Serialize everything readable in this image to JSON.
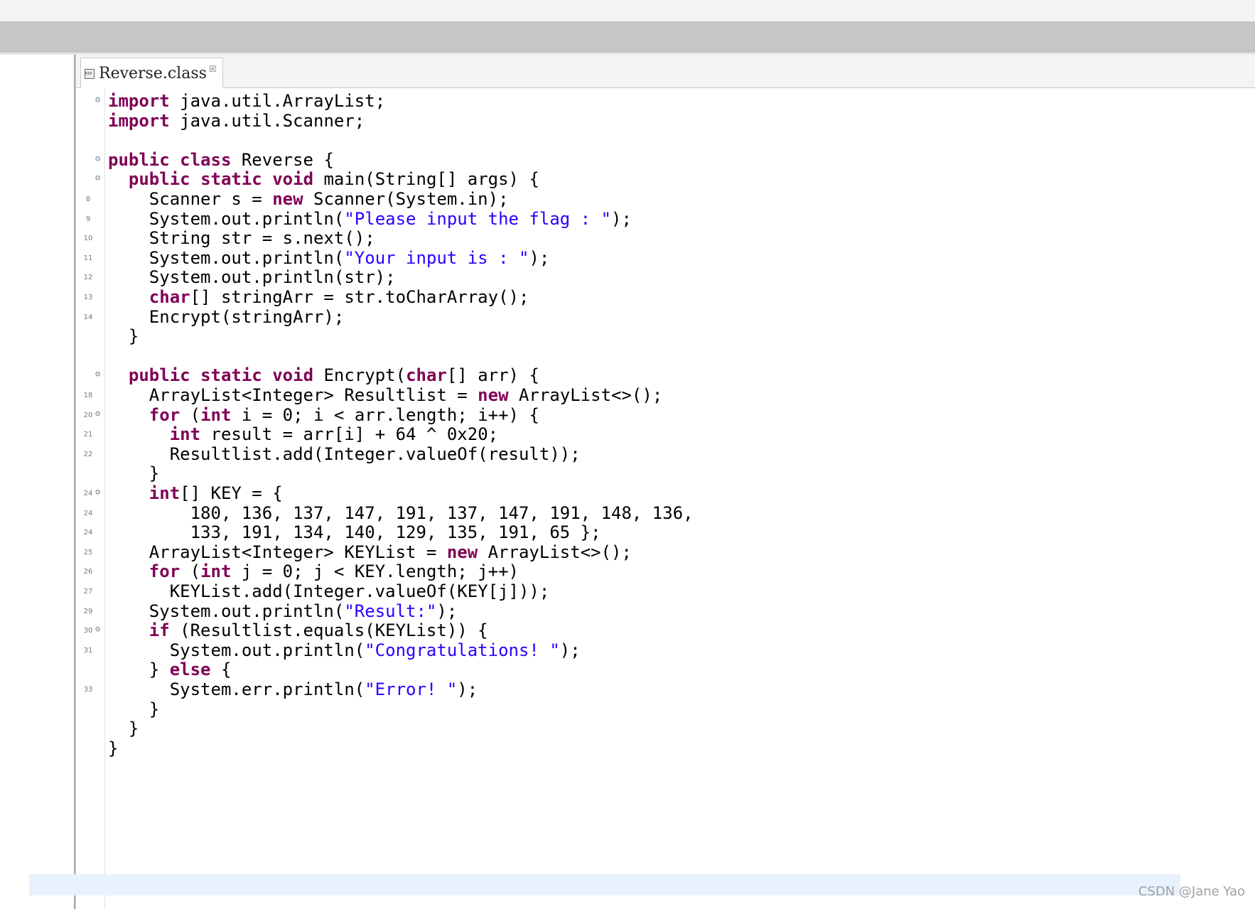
{
  "editor": {
    "tab_label": "Reverse.class",
    "close_glyph": "☒",
    "fold_glyph": "⊝"
  },
  "code_lines": [
    {
      "num": "",
      "fold": true,
      "segs": [
        {
          "t": "import",
          "k": "kw"
        },
        {
          "t": " java.util.ArrayList;"
        }
      ]
    },
    {
      "num": "",
      "fold": false,
      "segs": [
        {
          "t": "import",
          "k": "kw"
        },
        {
          "t": " java.util.Scanner;"
        }
      ]
    },
    {
      "num": "",
      "fold": false,
      "segs": []
    },
    {
      "num": "",
      "fold": true,
      "segs": [
        {
          "t": "public",
          "k": "kw"
        },
        {
          "t": " "
        },
        {
          "t": "class",
          "k": "kw"
        },
        {
          "t": " Reverse {"
        }
      ]
    },
    {
      "num": "",
      "fold": true,
      "segs": [
        {
          "t": "  "
        },
        {
          "t": "public",
          "k": "kw"
        },
        {
          "t": " "
        },
        {
          "t": "static",
          "k": "kw"
        },
        {
          "t": " "
        },
        {
          "t": "void",
          "k": "kw"
        },
        {
          "t": " main(String[] args) {"
        }
      ]
    },
    {
      "num": "8",
      "fold": false,
      "segs": [
        {
          "t": "    Scanner s = "
        },
        {
          "t": "new",
          "k": "kw"
        },
        {
          "t": " Scanner(System.in);"
        }
      ]
    },
    {
      "num": "9",
      "fold": false,
      "segs": [
        {
          "t": "    System.out.println("
        },
        {
          "t": "\"Please input the flag : \"",
          "k": "str"
        },
        {
          "t": ");"
        }
      ]
    },
    {
      "num": "10",
      "fold": false,
      "segs": [
        {
          "t": "    String str = s.next();"
        }
      ]
    },
    {
      "num": "11",
      "fold": false,
      "segs": [
        {
          "t": "    System.out.println("
        },
        {
          "t": "\"Your input is : \"",
          "k": "str"
        },
        {
          "t": ");"
        }
      ]
    },
    {
      "num": "12",
      "fold": false,
      "segs": [
        {
          "t": "    System.out.println(str);"
        }
      ]
    },
    {
      "num": "13",
      "fold": false,
      "segs": [
        {
          "t": "    "
        },
        {
          "t": "char",
          "k": "kw"
        },
        {
          "t": "[] stringArr = str.toCharArray();"
        }
      ]
    },
    {
      "num": "14",
      "fold": false,
      "segs": [
        {
          "t": "    Encrypt(stringArr);"
        }
      ]
    },
    {
      "num": "",
      "fold": false,
      "segs": [
        {
          "t": "  }"
        }
      ]
    },
    {
      "num": "",
      "fold": false,
      "segs": []
    },
    {
      "num": "",
      "fold": true,
      "segs": [
        {
          "t": "  "
        },
        {
          "t": "public",
          "k": "kw"
        },
        {
          "t": " "
        },
        {
          "t": "static",
          "k": "kw"
        },
        {
          "t": " "
        },
        {
          "t": "void",
          "k": "kw"
        },
        {
          "t": " Encrypt("
        },
        {
          "t": "char",
          "k": "kw"
        },
        {
          "t": "[] arr) {"
        }
      ]
    },
    {
      "num": "18",
      "fold": false,
      "segs": [
        {
          "t": "    ArrayList<Integer> Resultlist = "
        },
        {
          "t": "new",
          "k": "kw"
        },
        {
          "t": " ArrayList<>();"
        }
      ]
    },
    {
      "num": "20",
      "fold": true,
      "segs": [
        {
          "t": "    "
        },
        {
          "t": "for",
          "k": "kw"
        },
        {
          "t": " ("
        },
        {
          "t": "int",
          "k": "kw"
        },
        {
          "t": " i = 0; i < arr.length; i++) {"
        }
      ]
    },
    {
      "num": "21",
      "fold": false,
      "segs": [
        {
          "t": "      "
        },
        {
          "t": "int",
          "k": "kw"
        },
        {
          "t": " result = arr[i] + 64 ^ 0x20;"
        }
      ]
    },
    {
      "num": "22",
      "fold": false,
      "segs": [
        {
          "t": "      Resultlist.add(Integer.valueOf(result));"
        }
      ]
    },
    {
      "num": "",
      "fold": false,
      "segs": [
        {
          "t": "    }"
        }
      ]
    },
    {
      "num": "24",
      "fold": true,
      "segs": [
        {
          "t": "    "
        },
        {
          "t": "int",
          "k": "kw"
        },
        {
          "t": "[] KEY = {"
        }
      ]
    },
    {
      "num": "24",
      "fold": false,
      "segs": [
        {
          "t": "        180, 136, 137, 147, 191, 137, 147, 191, 148, 136,"
        }
      ]
    },
    {
      "num": "24",
      "fold": false,
      "segs": [
        {
          "t": "        133, 191, 134, 140, 129, 135, 191, 65 };"
        }
      ]
    },
    {
      "num": "25",
      "fold": false,
      "segs": [
        {
          "t": "    ArrayList<Integer> KEYList = "
        },
        {
          "t": "new",
          "k": "kw"
        },
        {
          "t": " ArrayList<>();"
        }
      ]
    },
    {
      "num": "26",
      "fold": false,
      "segs": [
        {
          "t": "    "
        },
        {
          "t": "for",
          "k": "kw"
        },
        {
          "t": " ("
        },
        {
          "t": "int",
          "k": "kw"
        },
        {
          "t": " j = 0; j < KEY.length; j++)"
        }
      ]
    },
    {
      "num": "27",
      "fold": false,
      "segs": [
        {
          "t": "      KEYList.add(Integer.valueOf(KEY[j]));"
        }
      ]
    },
    {
      "num": "29",
      "fold": false,
      "segs": [
        {
          "t": "    System.out.println("
        },
        {
          "t": "\"Result:\"",
          "k": "str"
        },
        {
          "t": ");"
        }
      ]
    },
    {
      "num": "30",
      "fold": true,
      "segs": [
        {
          "t": "    "
        },
        {
          "t": "if",
          "k": "kw"
        },
        {
          "t": " (Resultlist.equals(KEYList)) {"
        }
      ]
    },
    {
      "num": "31",
      "fold": false,
      "segs": [
        {
          "t": "      System.out.println("
        },
        {
          "t": "\"Congratulations! \"",
          "k": "str"
        },
        {
          "t": ");"
        }
      ]
    },
    {
      "num": "",
      "fold": false,
      "segs": [
        {
          "t": "    } "
        },
        {
          "t": "else",
          "k": "kw"
        },
        {
          "t": " {"
        }
      ]
    },
    {
      "num": "33",
      "fold": false,
      "segs": [
        {
          "t": "      System.err.println("
        },
        {
          "t": "\"Error! \"",
          "k": "str"
        },
        {
          "t": ");"
        }
      ]
    },
    {
      "num": "",
      "fold": false,
      "segs": [
        {
          "t": "    }"
        }
      ]
    },
    {
      "num": "",
      "fold": false,
      "segs": [
        {
          "t": "  }"
        }
      ]
    },
    {
      "num": "",
      "fold": false,
      "segs": [
        {
          "t": "}"
        }
      ]
    }
  ],
  "watermark": "CSDN @Jane Yao"
}
